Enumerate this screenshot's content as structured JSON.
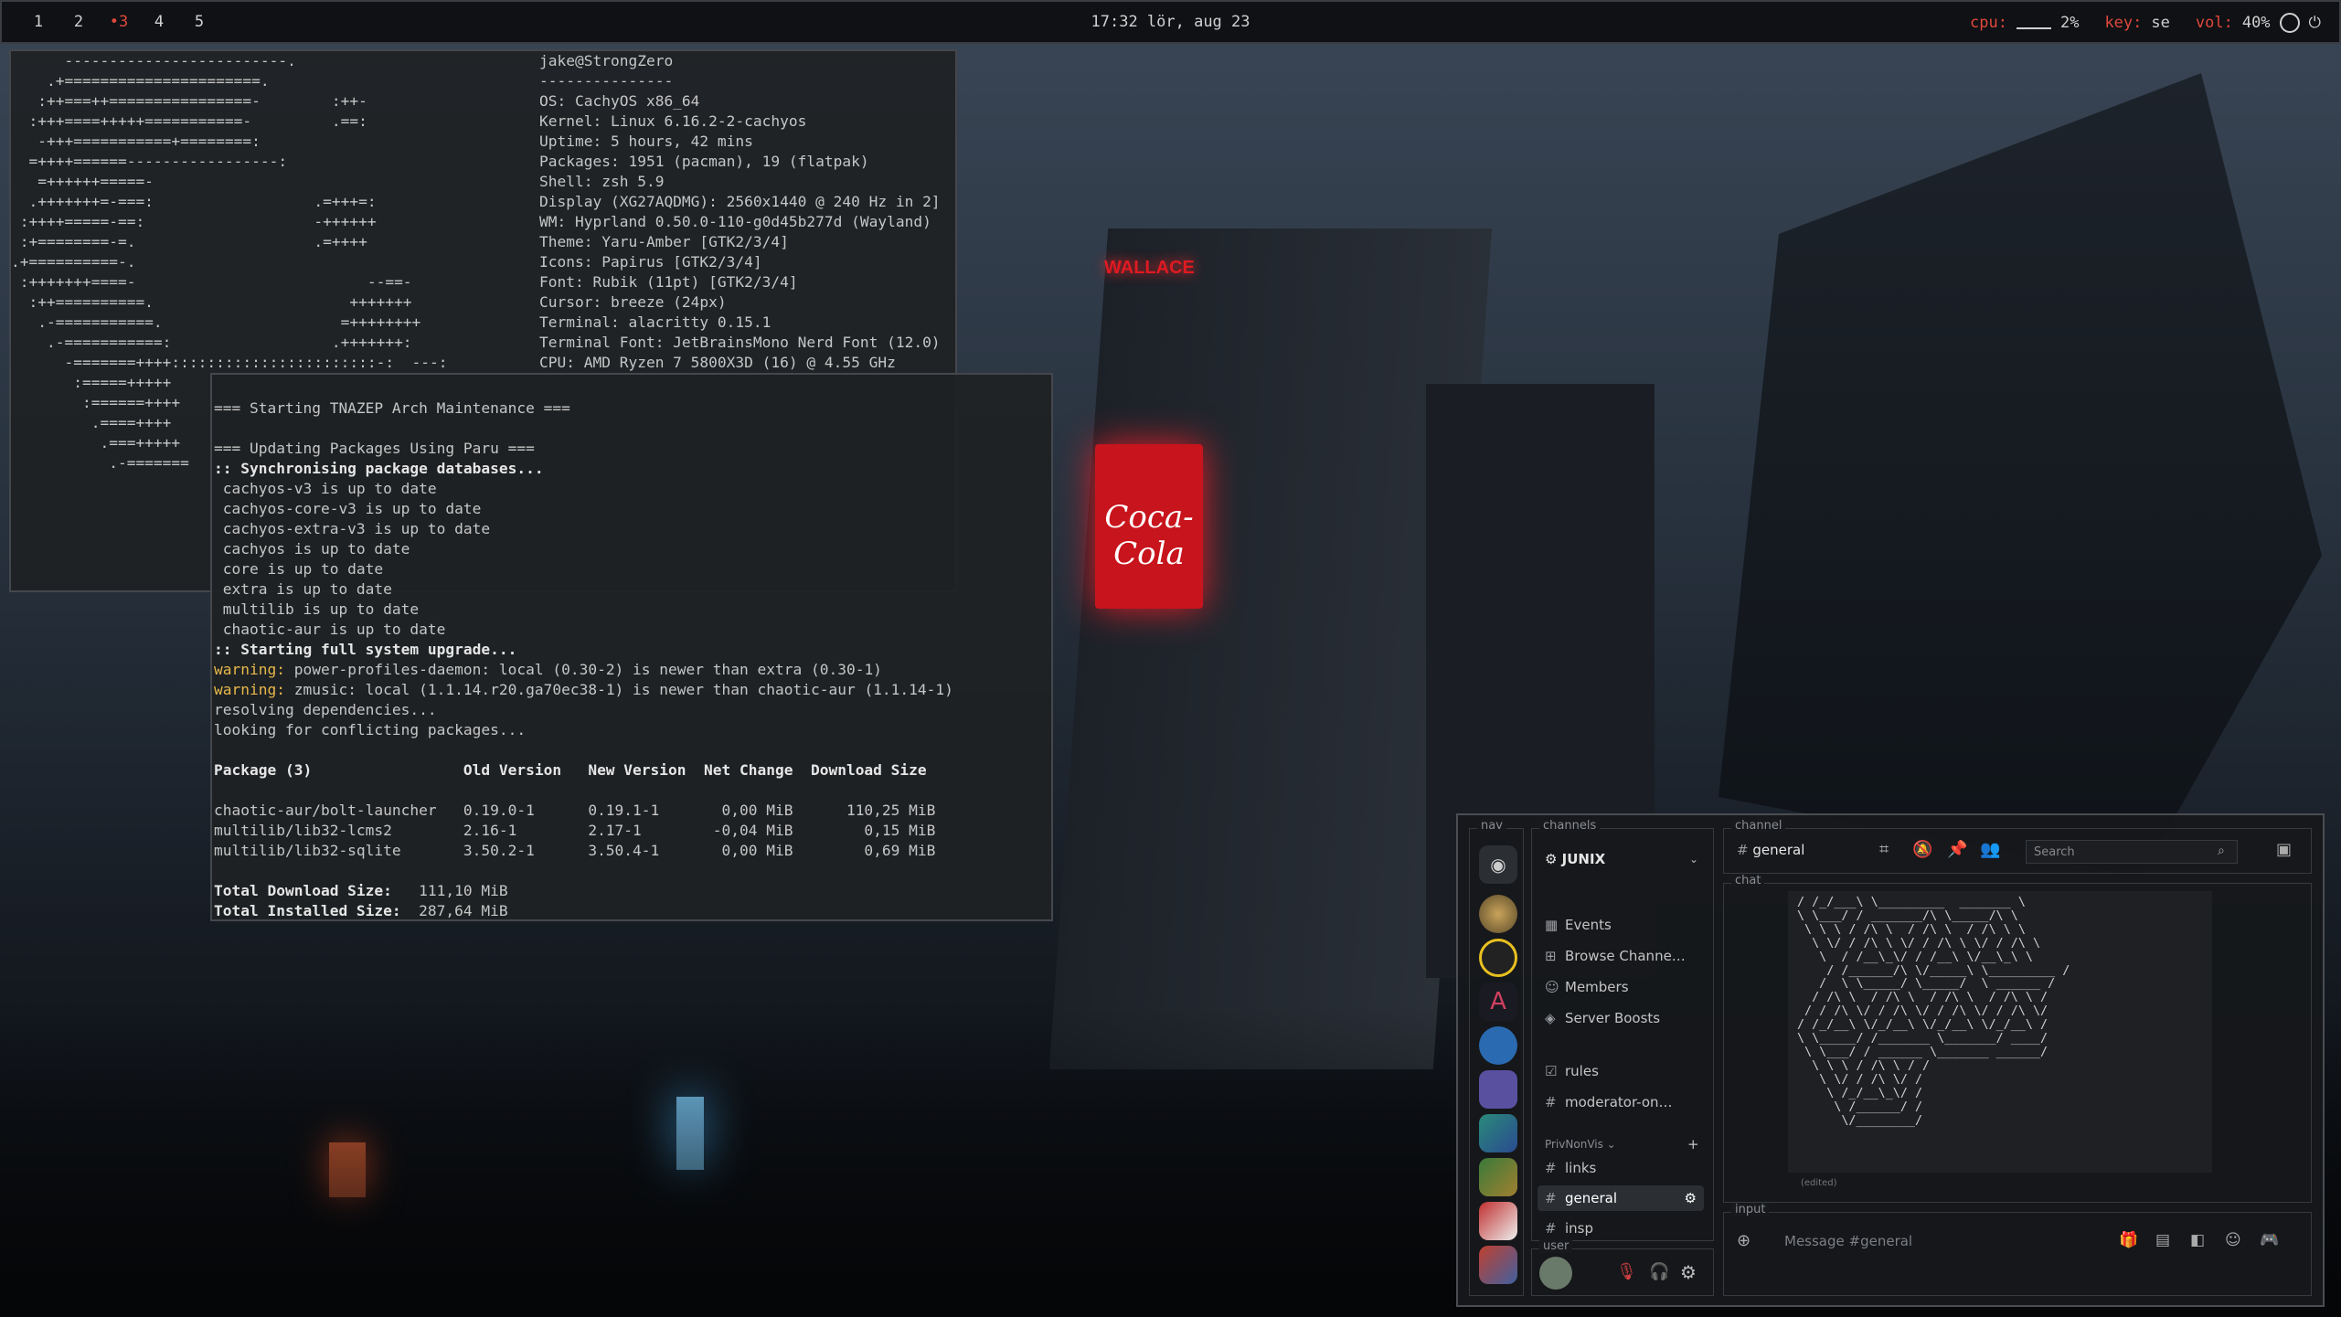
{
  "topbar": {
    "workspaces": [
      "1",
      "2",
      "•3",
      "4",
      "5"
    ],
    "clock": "17:32 lör, aug 23",
    "cpu_label": "cpu:",
    "cpu_value": "2%",
    "key_label": "key:",
    "key_value": "se",
    "vol_label": "vol:",
    "vol_value": "40%",
    "accent": "#e0483c"
  },
  "term1": {
    "logo": [
      "      -------------------------.",
      "    .+======================.",
      "   :++===++================-        :++-",
      "  :+++====+++++===========-         .==:",
      "   -+++===========+========:",
      "  =++++======-----------------:",
      "   =++++++=====-",
      "  .+++++++=-===:                  .=+++=:",
      " :++++=====-==:                   -++++++",
      " :+========-=.                    .=++++",
      ".+==========-.",
      " :+++++++====-                          --==-",
      "  :++==========.                      +++++++",
      "   .-===========.                    =++++++++",
      "    .-===========:                  .+++++++:",
      "      -=======++++:::::::::::::::::::::::-:  ---:",
      "       :=====+++++",
      "        :======++++",
      "         .====++++",
      "          .===+++++",
      "           .-======="
    ],
    "info": [
      "jake@StrongZero",
      "---------------",
      "OS: CachyOS x86_64",
      "Kernel: Linux 6.16.2-2-cachyos",
      "Uptime: 5 hours, 42 mins",
      "Packages: 1951 (pacman), 19 (flatpak)",
      "Shell: zsh 5.9",
      "Display (XG27AQDMG): 2560x1440 @ 240 Hz in 2]",
      "WM: Hyprland 0.50.0-110-g0d45b277d (Wayland)",
      "Theme: Yaru-Amber [GTK2/3/4]",
      "Icons: Papirus [GTK2/3/4]",
      "Font: Rubik (11pt) [GTK2/3/4]",
      "Cursor: breeze (24px)",
      "Terminal: alacritty 0.15.1",
      "Terminal Font: JetBrainsMono Nerd Font (12.0)",
      "CPU: AMD Ryzen 7 5800X3D (16) @ 4.55 GHz"
    ],
    "prompt_home": "⌂",
    "prompt_dir": "~",
    "prompt_arrow": "❯"
  },
  "term2": {
    "lines": [
      {
        "t": "=== Starting TNAZEP Arch Maintenance ===",
        "c": ""
      },
      {
        "t": "",
        "c": ""
      },
      {
        "t": "=== Updating Packages Using Paru ===",
        "c": ""
      },
      {
        "t": ":: Synchronising package databases...",
        "c": "bold"
      },
      {
        "t": " cachyos-v3 is up to date",
        "c": ""
      },
      {
        "t": " cachyos-core-v3 is up to date",
        "c": ""
      },
      {
        "t": " cachyos-extra-v3 is up to date",
        "c": ""
      },
      {
        "t": " cachyos is up to date",
        "c": ""
      },
      {
        "t": " core is up to date",
        "c": ""
      },
      {
        "t": " extra is up to date",
        "c": ""
      },
      {
        "t": " multilib is up to date",
        "c": ""
      },
      {
        "t": " chaotic-aur is up to date",
        "c": ""
      },
      {
        "t": ":: Starting full system upgrade...",
        "c": "bold"
      },
      {
        "w": "warning:",
        "t": " power-profiles-daemon: local (0.30-2) is newer than extra (0.30-1)",
        "c": ""
      },
      {
        "w": "warning:",
        "t": " zmusic: local (1.1.14.r20.ga70ec38-1) is newer than chaotic-aur (1.1.14-1)",
        "c": ""
      },
      {
        "t": "resolving dependencies...",
        "c": ""
      },
      {
        "t": "looking for conflicting packages...",
        "c": ""
      },
      {
        "t": "",
        "c": ""
      },
      {
        "t": "Package (3)                 Old Version   New Version  Net Change  Download Size",
        "c": "bold"
      },
      {
        "t": "",
        "c": ""
      },
      {
        "t": "chaotic-aur/bolt-launcher   0.19.0-1      0.19.1-1       0,00 MiB      110,25 MiB",
        "c": ""
      },
      {
        "t": "multilib/lib32-lcms2        2.16-1        2.17-1        -0,04 MiB        0,15 MiB",
        "c": ""
      },
      {
        "t": "multilib/lib32-sqlite       3.50.2-1      3.50.4-1       0,00 MiB        0,69 MiB",
        "c": ""
      },
      {
        "t": "",
        "c": ""
      },
      {
        "b": "Total Download Size:",
        "t": "   111,10 MiB",
        "c": ""
      },
      {
        "b": "Total Installed Size:",
        "t": "  287,64 MiB",
        "c": ""
      }
    ]
  },
  "wallpaper": {
    "sign_top": "WALLACE",
    "sign_coke": "Coca-Cola"
  },
  "discord": {
    "labels": {
      "nav": "nav",
      "channels": "channels",
      "channel": "channel",
      "chat": "chat",
      "user": "user",
      "input": "input"
    },
    "server_name": "JUNIX",
    "channels": [
      {
        "icon": "▦",
        "label": "Events"
      },
      {
        "icon": "⊞",
        "label": "Browse Channe…"
      },
      {
        "icon": "☺",
        "label": "Members"
      },
      {
        "icon": "◈",
        "label": "Server Boosts"
      },
      {
        "icon": "☑",
        "label": "rules"
      },
      {
        "icon": "#",
        "label": "moderator-on…"
      }
    ],
    "category": "PrivNonVis ⌄",
    "category_add": "+",
    "sub_channels": [
      {
        "icon": "#",
        "label": "links"
      },
      {
        "icon": "#",
        "label": "general"
      },
      {
        "icon": "#",
        "label": "insp"
      }
    ],
    "header_channel": "general",
    "search_placeholder": "Search",
    "message_placeholder": "Message #general",
    "edited": "(edited)",
    "art": [
      "/ /_/___\\ \\_________  _______ \\",
      "\\ \\___/ / _______/\\ \\_____/\\ \\",
      " \\ \\ \\ / /\\ \\  / /\\ \\  / /\\ \\ \\",
      "  \\ \\/ / /\\ \\ \\/ / /\\ \\ \\/ / /\\ \\",
      "   \\  / /__\\_\\/ / /__\\ \\/__\\_\\ \\",
      "    / /______/\\ \\/_____\\ \\_________ /",
      "   /  \\ \\_____/ \\_____/  \\ ______ /",
      "  / /\\ \\  / /\\ \\  / /\\ \\  / /\\ \\ /",
      " / / /\\ \\/ / /\\ \\/ / /\\ \\/ / /\\ \\/",
      "/ /_/__\\ \\/_/__\\ \\/_/__\\ \\/_/__\\ /",
      "\\ \\_____/ /_______ \\_______/ ____/",
      " \\ \\___/ / ______ \\_______ ______/",
      "  \\ \\ \\ / /\\ \\ / /",
      "   \\ \\/ / /\\ \\/ /",
      "    \\ /_/__\\_\\/ /",
      "     \\ /______/ /",
      "      \\/________/"
    ]
  }
}
